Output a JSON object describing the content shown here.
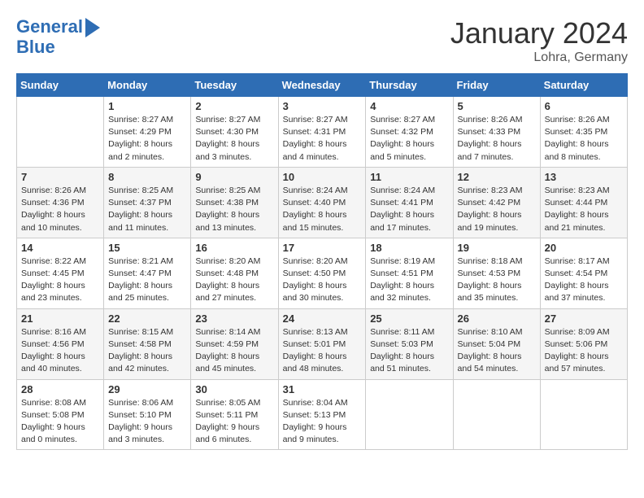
{
  "header": {
    "logo_line1": "General",
    "logo_line2": "Blue",
    "month": "January 2024",
    "location": "Lohra, Germany"
  },
  "weekdays": [
    "Sunday",
    "Monday",
    "Tuesday",
    "Wednesday",
    "Thursday",
    "Friday",
    "Saturday"
  ],
  "weeks": [
    [
      {
        "day": "",
        "info": ""
      },
      {
        "day": "1",
        "info": "Sunrise: 8:27 AM\nSunset: 4:29 PM\nDaylight: 8 hours\nand 2 minutes."
      },
      {
        "day": "2",
        "info": "Sunrise: 8:27 AM\nSunset: 4:30 PM\nDaylight: 8 hours\nand 3 minutes."
      },
      {
        "day": "3",
        "info": "Sunrise: 8:27 AM\nSunset: 4:31 PM\nDaylight: 8 hours\nand 4 minutes."
      },
      {
        "day": "4",
        "info": "Sunrise: 8:27 AM\nSunset: 4:32 PM\nDaylight: 8 hours\nand 5 minutes."
      },
      {
        "day": "5",
        "info": "Sunrise: 8:26 AM\nSunset: 4:33 PM\nDaylight: 8 hours\nand 7 minutes."
      },
      {
        "day": "6",
        "info": "Sunrise: 8:26 AM\nSunset: 4:35 PM\nDaylight: 8 hours\nand 8 minutes."
      }
    ],
    [
      {
        "day": "7",
        "info": "Sunrise: 8:26 AM\nSunset: 4:36 PM\nDaylight: 8 hours\nand 10 minutes."
      },
      {
        "day": "8",
        "info": "Sunrise: 8:25 AM\nSunset: 4:37 PM\nDaylight: 8 hours\nand 11 minutes."
      },
      {
        "day": "9",
        "info": "Sunrise: 8:25 AM\nSunset: 4:38 PM\nDaylight: 8 hours\nand 13 minutes."
      },
      {
        "day": "10",
        "info": "Sunrise: 8:24 AM\nSunset: 4:40 PM\nDaylight: 8 hours\nand 15 minutes."
      },
      {
        "day": "11",
        "info": "Sunrise: 8:24 AM\nSunset: 4:41 PM\nDaylight: 8 hours\nand 17 minutes."
      },
      {
        "day": "12",
        "info": "Sunrise: 8:23 AM\nSunset: 4:42 PM\nDaylight: 8 hours\nand 19 minutes."
      },
      {
        "day": "13",
        "info": "Sunrise: 8:23 AM\nSunset: 4:44 PM\nDaylight: 8 hours\nand 21 minutes."
      }
    ],
    [
      {
        "day": "14",
        "info": "Sunrise: 8:22 AM\nSunset: 4:45 PM\nDaylight: 8 hours\nand 23 minutes."
      },
      {
        "day": "15",
        "info": "Sunrise: 8:21 AM\nSunset: 4:47 PM\nDaylight: 8 hours\nand 25 minutes."
      },
      {
        "day": "16",
        "info": "Sunrise: 8:20 AM\nSunset: 4:48 PM\nDaylight: 8 hours\nand 27 minutes."
      },
      {
        "day": "17",
        "info": "Sunrise: 8:20 AM\nSunset: 4:50 PM\nDaylight: 8 hours\nand 30 minutes."
      },
      {
        "day": "18",
        "info": "Sunrise: 8:19 AM\nSunset: 4:51 PM\nDaylight: 8 hours\nand 32 minutes."
      },
      {
        "day": "19",
        "info": "Sunrise: 8:18 AM\nSunset: 4:53 PM\nDaylight: 8 hours\nand 35 minutes."
      },
      {
        "day": "20",
        "info": "Sunrise: 8:17 AM\nSunset: 4:54 PM\nDaylight: 8 hours\nand 37 minutes."
      }
    ],
    [
      {
        "day": "21",
        "info": "Sunrise: 8:16 AM\nSunset: 4:56 PM\nDaylight: 8 hours\nand 40 minutes."
      },
      {
        "day": "22",
        "info": "Sunrise: 8:15 AM\nSunset: 4:58 PM\nDaylight: 8 hours\nand 42 minutes."
      },
      {
        "day": "23",
        "info": "Sunrise: 8:14 AM\nSunset: 4:59 PM\nDaylight: 8 hours\nand 45 minutes."
      },
      {
        "day": "24",
        "info": "Sunrise: 8:13 AM\nSunset: 5:01 PM\nDaylight: 8 hours\nand 48 minutes."
      },
      {
        "day": "25",
        "info": "Sunrise: 8:11 AM\nSunset: 5:03 PM\nDaylight: 8 hours\nand 51 minutes."
      },
      {
        "day": "26",
        "info": "Sunrise: 8:10 AM\nSunset: 5:04 PM\nDaylight: 8 hours\nand 54 minutes."
      },
      {
        "day": "27",
        "info": "Sunrise: 8:09 AM\nSunset: 5:06 PM\nDaylight: 8 hours\nand 57 minutes."
      }
    ],
    [
      {
        "day": "28",
        "info": "Sunrise: 8:08 AM\nSunset: 5:08 PM\nDaylight: 9 hours\nand 0 minutes."
      },
      {
        "day": "29",
        "info": "Sunrise: 8:06 AM\nSunset: 5:10 PM\nDaylight: 9 hours\nand 3 minutes."
      },
      {
        "day": "30",
        "info": "Sunrise: 8:05 AM\nSunset: 5:11 PM\nDaylight: 9 hours\nand 6 minutes."
      },
      {
        "day": "31",
        "info": "Sunrise: 8:04 AM\nSunset: 5:13 PM\nDaylight: 9 hours\nand 9 minutes."
      },
      {
        "day": "",
        "info": ""
      },
      {
        "day": "",
        "info": ""
      },
      {
        "day": "",
        "info": ""
      }
    ]
  ]
}
